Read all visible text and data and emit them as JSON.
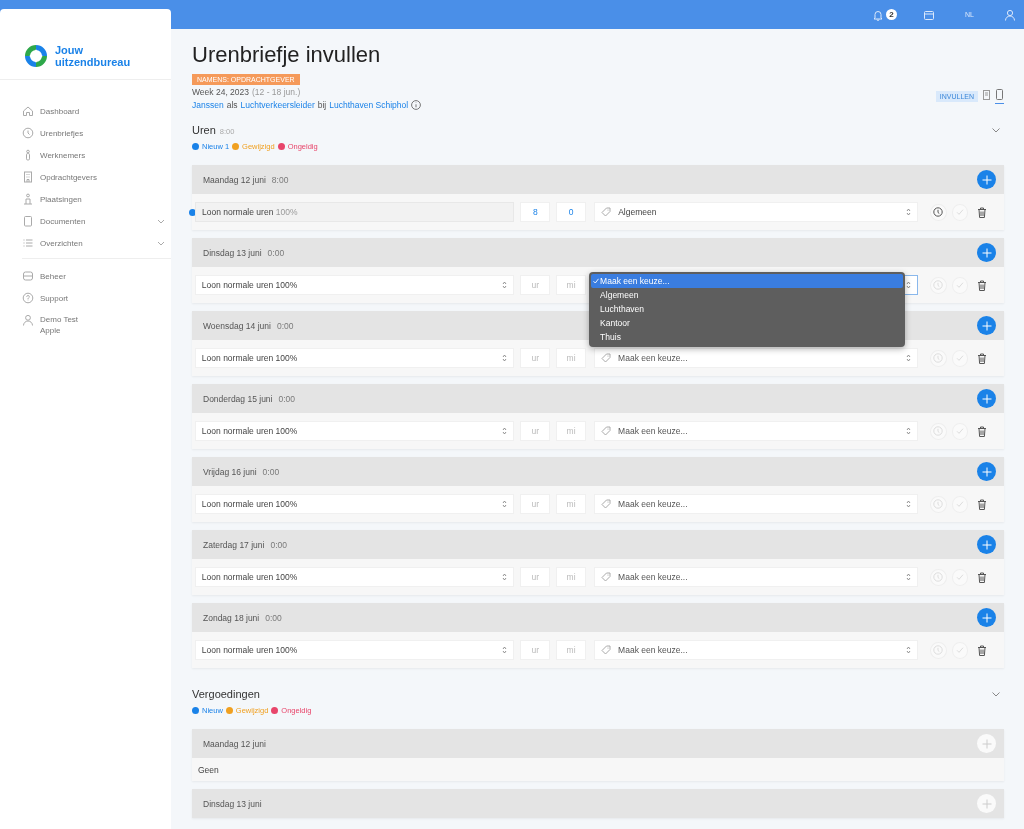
{
  "topbar": {
    "notification_count": "2",
    "language": "NL"
  },
  "sidebar": {
    "logo": {
      "line_1": "Jouw",
      "line_2": "uitzendbureau"
    },
    "groups": [
      [
        {
          "label": "Dashboard",
          "expandable": false
        },
        {
          "label": "Urenbriefjes",
          "expandable": false
        },
        {
          "label": "Werknemers",
          "expandable": false
        },
        {
          "label": "Opdrachtgevers",
          "expandable": false
        },
        {
          "label": "Plaatsingen",
          "expandable": false
        },
        {
          "label": "Documenten",
          "expandable": true
        },
        {
          "label": "Overzichten",
          "expandable": true
        }
      ],
      [
        {
          "label": "Beheer",
          "expandable": false
        },
        {
          "label": "Support",
          "expandable": false
        },
        {
          "label": "Demo Test Apple",
          "expandable": false
        }
      ]
    ]
  },
  "header": {
    "title": "Urenbriefje invullen",
    "badge": "NAMENS: OPDRACHTGEVER",
    "week": "Week 24, 2023",
    "range": "(12 - 18 jun.)",
    "assignment": [
      {
        "text": "Janssen",
        "link": true
      },
      {
        "text": "als",
        "link": false
      },
      {
        "text": "Luchtverkeersleider",
        "link": true
      },
      {
        "text": "bij",
        "link": false
      },
      {
        "text": "Luchthaven Schiphol",
        "link": true
      }
    ],
    "mode": "INVULLEN",
    "views": [
      {
        "selected": false
      },
      {
        "selected": true
      }
    ]
  },
  "uren": {
    "title": "Uren",
    "total": "8:00",
    "expanded": true,
    "legend": [
      {
        "label": "Nieuw 1",
        "color": "#1a82e8"
      },
      {
        "label": "Gewijzigd",
        "color": "#f0a020"
      },
      {
        "label": "Ongeldig",
        "color": "#e8456a"
      }
    ],
    "days": [
      {
        "title": "Maandag 12 juni",
        "total": "8:00",
        "add_active": true,
        "entries": [
          {
            "type": "Loon normale uren",
            "rate": "100%",
            "locked": true,
            "color": "#1a82e8",
            "hours": "8",
            "minutes": "0",
            "location": "Algemeen",
            "history_active": true,
            "approve_active": false
          }
        ]
      },
      {
        "title": "Dinsdag 13 juni",
        "total": "0:00",
        "add_active": true,
        "entries": [
          {
            "type": "Loon normale uren",
            "rate": "100%",
            "locked": false,
            "hours_placeholder": "ur",
            "minutes_placeholder": "mi",
            "history_active": false,
            "approve_active": false,
            "dropdown": {
              "open": true,
              "options": [
                {
                  "label": "Maak een keuze...",
                  "selected": true
                },
                {
                  "label": "Algemeen",
                  "selected": false
                },
                {
                  "label": "Luchthaven",
                  "selected": false
                },
                {
                  "label": "Kantoor",
                  "selected": false
                },
                {
                  "label": "Thuis",
                  "selected": false
                }
              ]
            }
          }
        ]
      },
      {
        "title": "Woensdag 14 juni",
        "total": "0:00",
        "add_active": true,
        "entries": [
          {
            "type": "Loon normale uren",
            "rate": "100%",
            "locked": false,
            "hours_placeholder": "ur",
            "minutes_placeholder": "mi",
            "location_placeholder": "Maak een keuze...",
            "history_active": false,
            "approve_active": false
          }
        ]
      },
      {
        "title": "Donderdag 15 juni",
        "total": "0:00",
        "add_active": true,
        "entries": [
          {
            "type": "Loon normale uren",
            "rate": "100%",
            "locked": false,
            "hours_placeholder": "ur",
            "minutes_placeholder": "mi",
            "location_placeholder": "Maak een keuze...",
            "history_active": false,
            "approve_active": false
          }
        ]
      },
      {
        "title": "Vrijdag 16 juni",
        "total": "0:00",
        "add_active": true,
        "entries": [
          {
            "type": "Loon normale uren",
            "rate": "100%",
            "locked": false,
            "hours_placeholder": "ur",
            "minutes_placeholder": "mi",
            "location_placeholder": "Maak een keuze...",
            "history_active": false,
            "approve_active": false
          }
        ]
      },
      {
        "title": "Zaterdag 17 juni",
        "total": "0:00",
        "add_active": true,
        "entries": [
          {
            "type": "Loon normale uren",
            "rate": "100%",
            "locked": false,
            "hours_placeholder": "ur",
            "minutes_placeholder": "mi",
            "location_placeholder": "Maak een keuze...",
            "history_active": false,
            "approve_active": false
          }
        ]
      },
      {
        "title": "Zondag 18 juni",
        "total": "0:00",
        "add_active": true,
        "entries": [
          {
            "type": "Loon normale uren",
            "rate": "100%",
            "locked": false,
            "hours_placeholder": "ur",
            "minutes_placeholder": "mi",
            "location_placeholder": "Maak een keuze...",
            "history_active": false,
            "approve_active": false
          }
        ]
      }
    ]
  },
  "vergoedingen": {
    "title": "Vergoedingen",
    "expanded": true,
    "legend": [
      {
        "label": "Nieuw",
        "color": "#1a82e8"
      },
      {
        "label": "Gewijzigd",
        "color": "#f0a020"
      },
      {
        "label": "Ongeldig",
        "color": "#e8456a"
      }
    ],
    "days": [
      {
        "title": "Maandag 12 juni",
        "add_active": false,
        "empty_text": "Geen"
      },
      {
        "title": "Dinsdag 13 juni",
        "add_active": false
      }
    ]
  }
}
